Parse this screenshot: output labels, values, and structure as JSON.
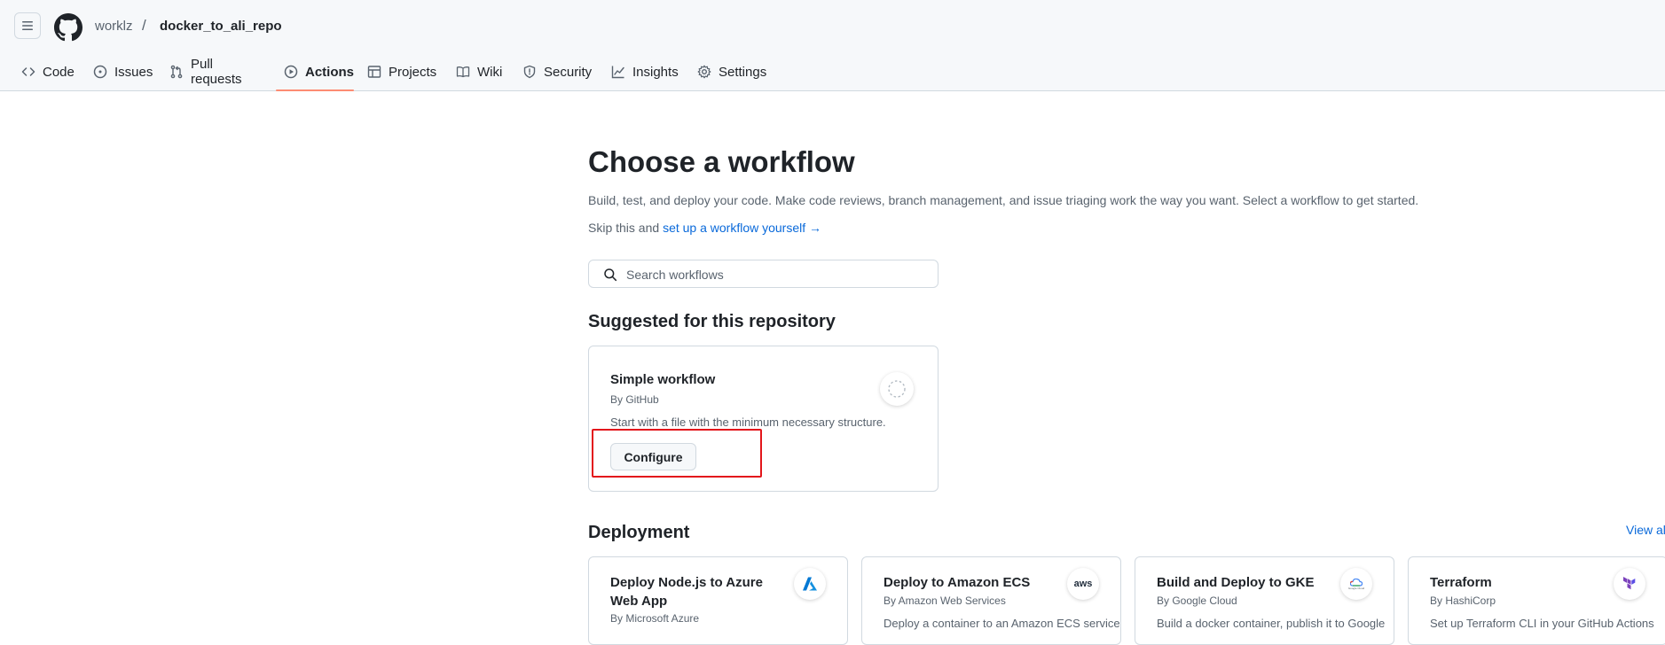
{
  "header": {
    "owner": "worklz",
    "separator": "/",
    "repo": "docker_to_ali_repo"
  },
  "nav": {
    "tabs": [
      {
        "label": "Code",
        "icon": "code-icon"
      },
      {
        "label": "Issues",
        "icon": "issue-opened-icon"
      },
      {
        "label": "Pull requests",
        "icon": "git-pull-request-icon"
      },
      {
        "label": "Actions",
        "icon": "play-icon",
        "active": true
      },
      {
        "label": "Projects",
        "icon": "table-icon"
      },
      {
        "label": "Wiki",
        "icon": "book-icon"
      },
      {
        "label": "Security",
        "icon": "shield-icon"
      },
      {
        "label": "Insights",
        "icon": "graph-icon"
      },
      {
        "label": "Settings",
        "icon": "gear-icon"
      }
    ]
  },
  "main": {
    "title": "Choose a workflow",
    "description": "Build, test, and deploy your code. Make code reviews, branch management, and issue triaging work the way you want. Select a workflow to get started.",
    "skip_prefix": "Skip this and",
    "skip_link": "set up a workflow yourself",
    "skip_arrow": "→",
    "search_placeholder": "Search workflows",
    "suggested_heading": "Suggested for this repository",
    "suggested_card": {
      "title": "Simple workflow",
      "author": "By GitHub",
      "description": "Start with a file with the minimum necessary structure.",
      "button": "Configure"
    },
    "deployment_heading": "Deployment",
    "view_all": "View all",
    "deployment_cards": [
      {
        "title_line1": "Deploy Node.js to Azure",
        "title_line2": "Web App",
        "author": "By Microsoft Azure",
        "description": "",
        "icon": "azure-icon"
      },
      {
        "title_line1": "Deploy to Amazon ECS",
        "title_line2": "",
        "author": "By Amazon Web Services",
        "description": "Deploy a container to an Amazon ECS service",
        "icon": "aws-icon",
        "icon_text": "aws"
      },
      {
        "title_line1": "Build and Deploy to GKE",
        "title_line2": "",
        "author": "By Google Cloud",
        "description": "Build a docker container, publish it to Google",
        "icon": "google-cloud-icon",
        "icon_text": "Google Cloud"
      },
      {
        "title_line1": "Terraform",
        "title_line2": "",
        "author": "By HashiCorp",
        "description": "Set up Terraform CLI in your GitHub Actions",
        "icon": "terraform-icon"
      }
    ]
  },
  "colors": {
    "accent_link": "#0969da",
    "active_tab_underline": "#fd8c73",
    "highlight_box": "#e3161b",
    "header_bg": "#f6f8fa"
  }
}
